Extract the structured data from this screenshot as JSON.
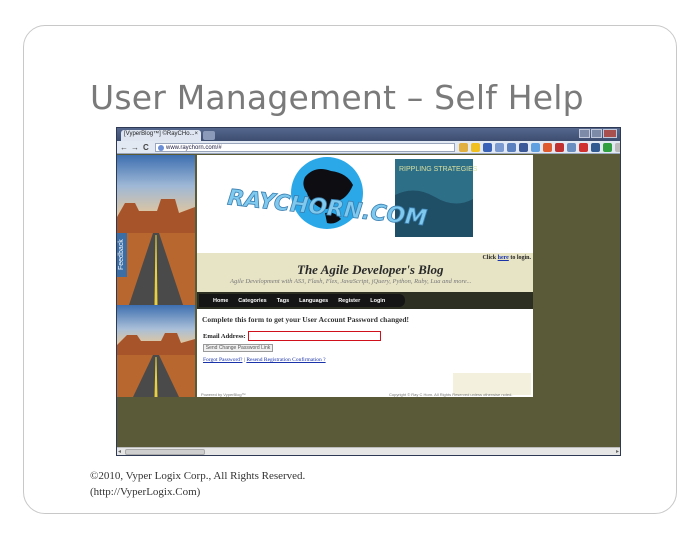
{
  "slide": {
    "title": "User Management – Self Help",
    "footer_line1": "©2010, Vyper Logix Corp., All Rights Reserved.",
    "footer_line2": "(http://VyperLogix.Com)"
  },
  "browser": {
    "tab_title": "[VyperBlog™] ©RayCHo...",
    "tab_close": "×",
    "nav_back": "←",
    "nav_forward": "→",
    "nav_reload": "C",
    "url": "www.raychorn.com/#",
    "scroll_left": "◂",
    "scroll_right": "▸",
    "colors": {
      "titlebar": "#3c4d70",
      "viewport_bg": "#5b5a38"
    }
  },
  "site": {
    "feedback_label": "Feedback",
    "logo_text": "RAYCHORN.COM",
    "rippling_text": "RIPPLING STRATEGIES",
    "login_prefix": "Click ",
    "login_link": "here",
    "login_suffix": " to login.",
    "blog_title": "The Agile Developer's Blog",
    "blog_subtitle": "Agile Development with AS3, Flash, Flex, JavaScript, jQuery, Python, Ruby, Lua and more...",
    "menu": [
      "Home",
      "Categories",
      "Tags",
      "Languages",
      "Register",
      "Login"
    ],
    "form_title": "Complete this form to get your User Account Password changed!",
    "email_label": "Email Address:",
    "email_value": "",
    "send_button": "Send Change Password Link",
    "link_forgot": "Forgot Password?",
    "link_sep": " | ",
    "link_resend": "Resend Registration Confirmation ?",
    "footer_left": "Powered by VyperBlog™",
    "footer_right": "Copyright © Ray C Horn. All Rights Reserved unless otherwise noted."
  }
}
